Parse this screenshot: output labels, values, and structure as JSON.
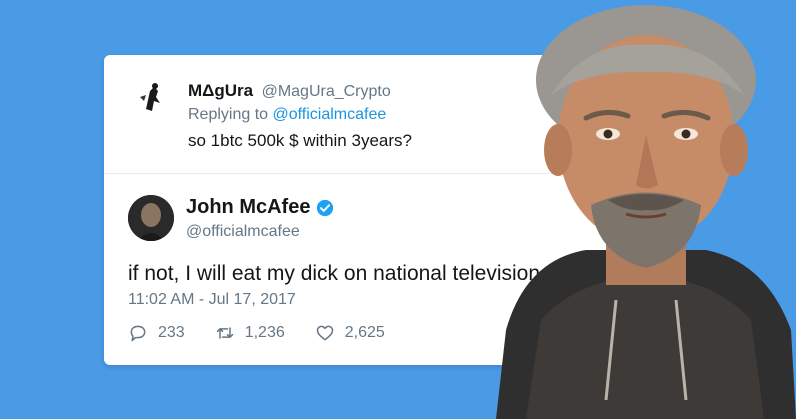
{
  "reply": {
    "name": "MΔgUra",
    "handle": "@MagUra_Crypto",
    "replying_prefix": "Replying to",
    "replying_to": "@officialmcafee",
    "text": "so 1btc 500k $ within 3years?"
  },
  "tweet": {
    "name": "John McAfee",
    "handle": "@officialmcafee",
    "text": "if not, I will eat my dick on national television.",
    "timestamp": "11:02 AM - Jul 17, 2017",
    "replies": "233",
    "retweets": "1,236",
    "likes": "2,625"
  },
  "icons": {
    "reply": "comment-icon",
    "retweet": "retweet-icon",
    "like": "heart-icon",
    "verified": "verified-badge-icon"
  },
  "colors": {
    "background": "#4a9be6",
    "link": "#1b95e0",
    "secondary_text": "#657786",
    "verified": "#1da1f2"
  }
}
